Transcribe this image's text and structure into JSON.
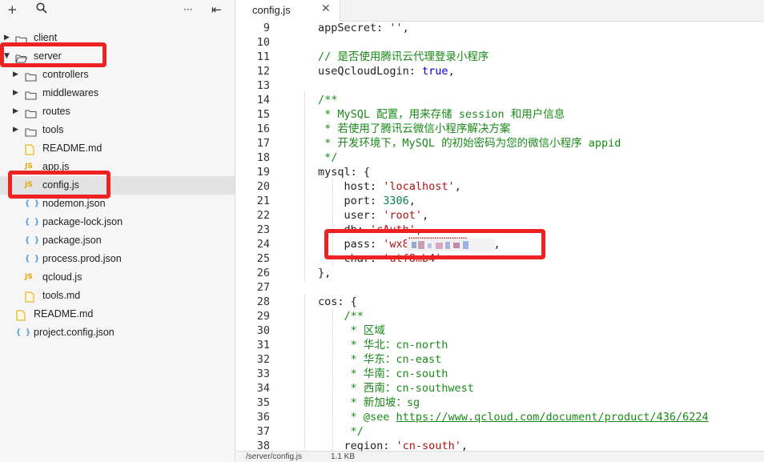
{
  "sidebar": {
    "toolbar": {
      "add_icon": "+",
      "search_icon": "⌕",
      "more_icon": "···",
      "collapse_icon": "⇤"
    },
    "tree": [
      {
        "label": "client",
        "type": "folder",
        "arrow": "▶",
        "indent": 0
      },
      {
        "label": "server",
        "type": "folder",
        "arrow": "▼",
        "indent": 0,
        "highlighted": true
      },
      {
        "label": "controllers",
        "type": "folder",
        "arrow": "▶",
        "indent": 1
      },
      {
        "label": "middlewares",
        "type": "folder",
        "arrow": "▶",
        "indent": 1
      },
      {
        "label": "routes",
        "type": "folder",
        "arrow": "▶",
        "indent": 1
      },
      {
        "label": "tools",
        "type": "folder",
        "arrow": "▶",
        "indent": 1
      },
      {
        "label": "README.md",
        "type": "md",
        "indent": 1
      },
      {
        "label": "app.js",
        "type": "js",
        "indent": 1
      },
      {
        "label": "config.js",
        "type": "js",
        "indent": 1,
        "selected": true,
        "highlighted": true
      },
      {
        "label": "nodemon.json",
        "type": "json",
        "indent": 1
      },
      {
        "label": "package-lock.json",
        "type": "json",
        "indent": 1
      },
      {
        "label": "package.json",
        "type": "json",
        "indent": 1
      },
      {
        "label": "process.prod.json",
        "type": "json",
        "indent": 1
      },
      {
        "label": "qcloud.js",
        "type": "js",
        "indent": 1
      },
      {
        "label": "tools.md",
        "type": "md",
        "indent": 1
      },
      {
        "label": "README.md",
        "type": "md",
        "indent": 0
      },
      {
        "label": "project.config.json",
        "type": "json",
        "indent": 0
      }
    ]
  },
  "editor": {
    "tab": {
      "label": "config.js",
      "close_icon": "✕"
    },
    "lines": [
      {
        "n": "9",
        "code": "appSecret: '',"
      },
      {
        "n": "10",
        "code": ""
      },
      {
        "n": "11",
        "code": "// 是否使用腾讯云代理登录小程序"
      },
      {
        "n": "12",
        "code": "useQcloudLogin: true,"
      },
      {
        "n": "13",
        "code": ""
      },
      {
        "n": "14",
        "code": "/**"
      },
      {
        "n": "15",
        "code": " * MySQL 配置，用来存储 session 和用户信息"
      },
      {
        "n": "16",
        "code": " * 若使用了腾讯云微信小程序解决方案"
      },
      {
        "n": "17",
        "code": " * 开发环境下，MySQL 的初始密码为您的微信小程序 appid"
      },
      {
        "n": "18",
        "code": " */"
      },
      {
        "n": "19",
        "code": "mysql: {"
      },
      {
        "n": "20",
        "code": "    host: 'localhost',"
      },
      {
        "n": "21",
        "code": "    port: 3306,"
      },
      {
        "n": "22",
        "code": "    user: 'root',"
      },
      {
        "n": "23",
        "code": "    db: 'cAuth',"
      },
      {
        "n": "24",
        "code": "    pass: 'wx8▒▒▒▒▒▒▒▒▒347',"
      },
      {
        "n": "25",
        "code": "    char: 'utf8mb4'"
      },
      {
        "n": "26",
        "code": "},"
      },
      {
        "n": "27",
        "code": ""
      },
      {
        "n": "28",
        "code": "cos: {"
      },
      {
        "n": "29",
        "code": "    /**"
      },
      {
        "n": "30",
        "code": "     * 区域"
      },
      {
        "n": "31",
        "code": "     * 华北：cn-north"
      },
      {
        "n": "32",
        "code": "     * 华东：cn-east"
      },
      {
        "n": "33",
        "code": "     * 华南：cn-south"
      },
      {
        "n": "34",
        "code": "     * 西南：cn-southwest"
      },
      {
        "n": "35",
        "code": "     * 新加坡：sg"
      },
      {
        "n": "36",
        "code": "     * @see https://www.qcloud.com/document/product/436/6224"
      },
      {
        "n": "37",
        "code": "     */"
      },
      {
        "n": "38",
        "code": "    region: 'cn-south',"
      }
    ]
  },
  "statusbar": {
    "path": "/server/config.js",
    "size": "1.1 KB"
  },
  "colors": {
    "highlight_red": "#ee2222",
    "sidebar_bg": "#f6f6f6",
    "selected_bg": "#e3e3e3",
    "folder_icon": "#555555",
    "js_icon": "#e3a700",
    "json_icon": "#3a8ee6"
  }
}
